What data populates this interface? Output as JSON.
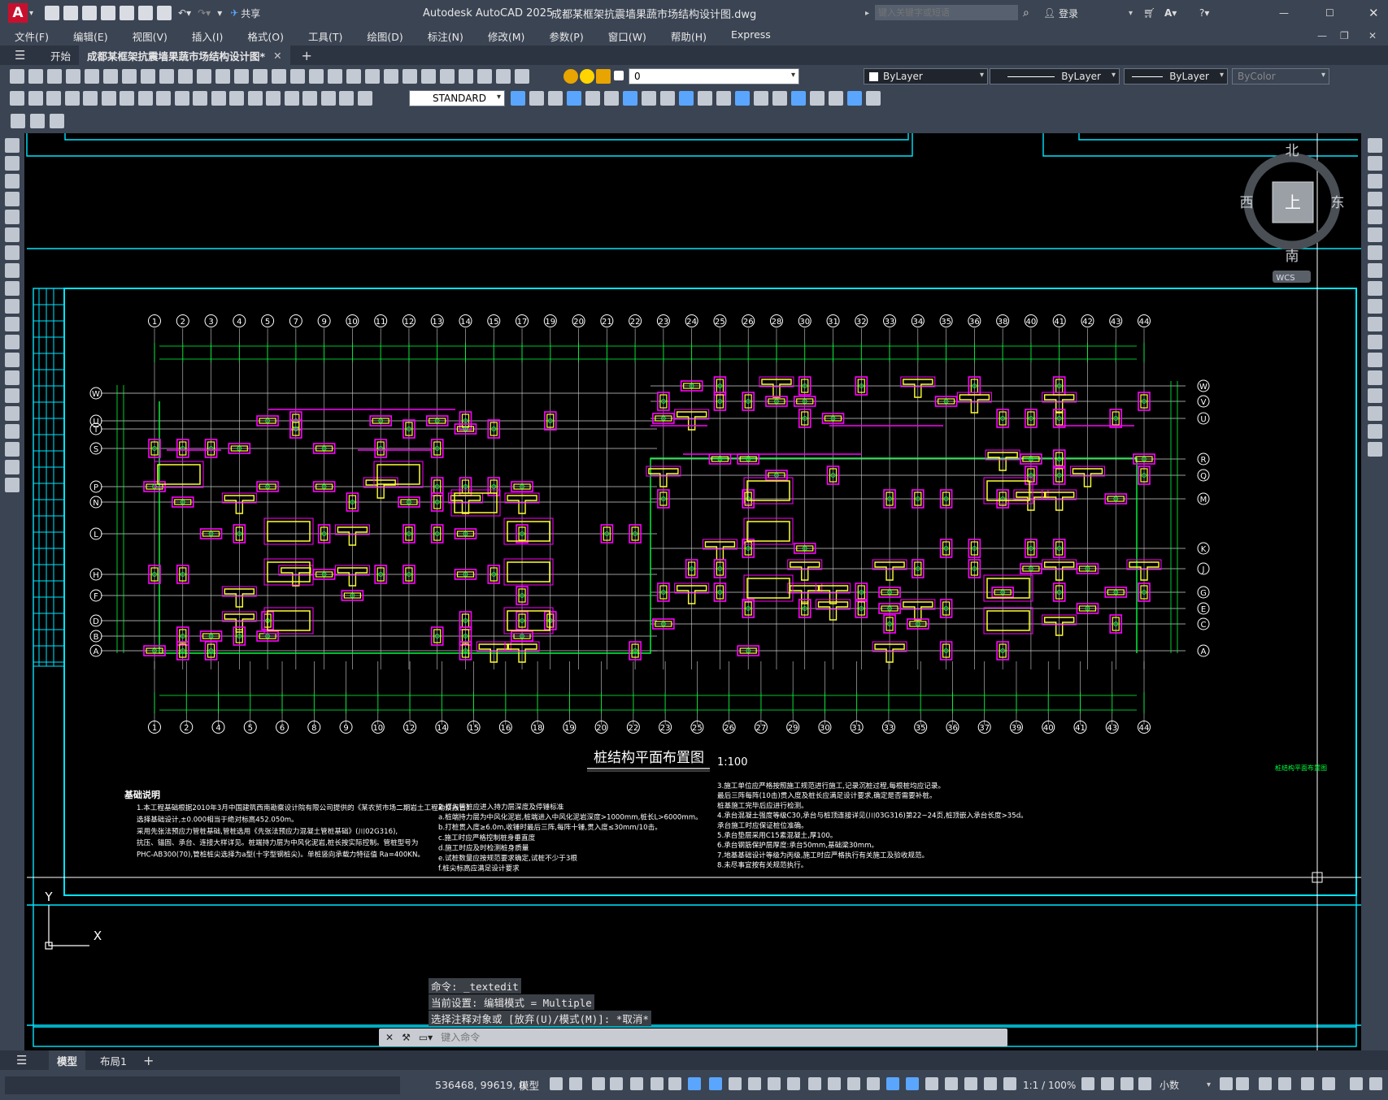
{
  "app": {
    "title": "Autodesk AutoCAD 2025",
    "document": "成都某框架抗震墙果蔬市场结构设计图.dwg",
    "share_label": "共享",
    "search_placeholder": "键入关键字或短语",
    "login_label": "登录"
  },
  "menu": [
    "文件(F)",
    "编辑(E)",
    "视图(V)",
    "插入(I)",
    "格式(O)",
    "工具(T)",
    "绘图(D)",
    "标注(N)",
    "修改(M)",
    "参数(P)",
    "窗口(W)",
    "帮助(H)",
    "Express"
  ],
  "doc_tabs": {
    "start": "开始",
    "active": "成都某框架抗震墙果蔬市场结构设计图*"
  },
  "toolbar": {
    "layer_value": "0",
    "text_style": "STANDARD",
    "color": "ByLayer",
    "linetype": "ByLayer",
    "lineweight": "ByLayer",
    "plotstyle": "ByColor"
  },
  "viewcube": {
    "north": "北",
    "south": "南",
    "east": "东",
    "west": "西",
    "face": "上",
    "wcs": "WCS"
  },
  "drawing": {
    "title": "桩结构平面布置图",
    "scale": "1:100",
    "side_label": "桩结构平面布置图",
    "top_axes": [
      "1",
      "2",
      "3",
      "4",
      "5",
      "7",
      "9",
      "10",
      "11",
      "12",
      "13",
      "14",
      "15",
      "17",
      "19",
      "20",
      "21",
      "22",
      "23",
      "24",
      "25",
      "26",
      "28",
      "30",
      "31",
      "32",
      "33",
      "34",
      "35",
      "36",
      "38",
      "40",
      "41",
      "42",
      "43",
      "44"
    ],
    "bottom_axes": [
      "1",
      "2",
      "4",
      "5",
      "6",
      "8",
      "9",
      "10",
      "12",
      "14",
      "15",
      "16",
      "18",
      "19",
      "20",
      "22",
      "23",
      "25",
      "26",
      "27",
      "29",
      "30",
      "31",
      "33",
      "35",
      "36",
      "37",
      "39",
      "40",
      "41",
      "43",
      "44"
    ],
    "left_axes": [
      "W",
      "U",
      "T",
      "S",
      "P",
      "N",
      "L",
      "H",
      "F",
      "D",
      "B",
      "A"
    ],
    "right_axes": [
      "W",
      "V",
      "U",
      "R",
      "Q",
      "M",
      "K",
      "J",
      "G",
      "E",
      "C",
      "A"
    ],
    "notes_heading": "基础说明",
    "notes_col1": [
      "1.本工程基础根据2010年3月中国建筑西南勘察设计院有限公司提供的《某农贸市场二期岩土工程勘察报告》",
      "选择基础设计,±0.000相当于绝对标高452.050m。",
      "采用先张法预应力管桩基础,管桩选用《先张法预应力混凝土管桩基础》(川02G316),",
      "抗压、锚固、承台、连接大样详见。桩端持力层为中风化泥岩,桩长按实际控制。管桩型号为",
      "PHC-AB300(70),管桩桩尖选择为a型(十字型钢桩尖)。单桩竖向承载力特征值 Ra=400KN。"
    ],
    "notes_col2": [
      "2.打入管桩应进入持力层深度及停锤标准",
      "a.桩端持力层为中风化泥岩,桩端进入中风化泥岩深度>1000mm,桩长L>6000mm。",
      "b.打桩贯入度≥6.0m,收锤时最后三阵,每阵十锤,贯入度≤30mm/10击。",
      "c.施工时应严格控制桩身垂直度",
      "d.施工时应及时检测桩身质量",
      "e.试桩数量应按规范要求确定,试桩不少于3根",
      "f.桩尖标高应满足设计要求"
    ],
    "notes_col3": [
      "3.施工单位应严格按照施工规范进行施工,记录沉桩过程,每根桩均应记录。",
      "最后三阵每阵(10击)贯入度及桩长应满足设计要求,确定是否需要补桩。",
      "桩基施工完毕后应进行检测。",
      "4.承台混凝土强度等级C30,承台与桩顶连接详见(川03G316)第22~24页,桩顶嵌入承台长度>35d。",
      "承台施工时应保证桩位准确。",
      "5.承台垫层采用C15素混凝土,厚100。",
      "6.承台钢筋保护层厚度:承台50mm,基础梁30mm。",
      "7.地基基础设计等级为丙级,施工时应严格执行有关施工及验收规范。",
      "8.未尽事宜按有关规范执行。"
    ]
  },
  "command": {
    "history": [
      "命令: _textedit",
      "当前设置: 编辑模式 = Multiple",
      "选择注释对象或 [放弃(U)/模式(M)]: *取消*"
    ],
    "placeholder": "键入命令"
  },
  "layout_tabs": [
    "模型",
    "布局1"
  ],
  "status": {
    "coords": "536468, 99619, 0",
    "space": "模型",
    "annoscale": "1:1 / 100%",
    "units": "小数"
  },
  "colors": {
    "cyan": "#00e5ff",
    "green": "#00ff3c",
    "magenta": "#ff00ff",
    "yellow": "#ffff33",
    "white": "#ffffff",
    "chrome": "#3b4453"
  }
}
